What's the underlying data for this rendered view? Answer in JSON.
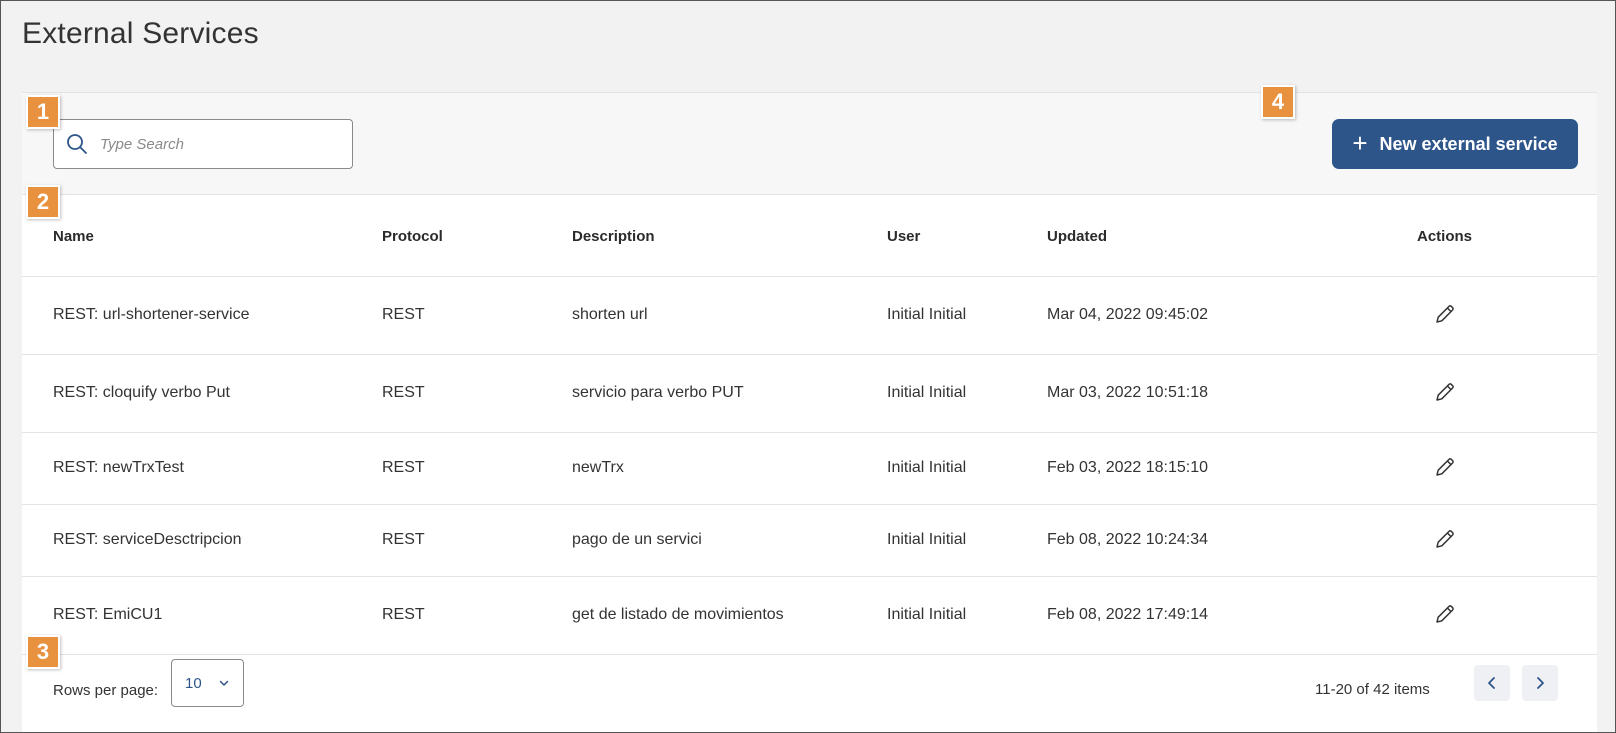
{
  "page": {
    "title": "External Services"
  },
  "toolbar": {
    "search_placeholder": "Type Search",
    "search_value": "",
    "new_button_label": "New external service"
  },
  "badges": [
    "1",
    "2",
    "3",
    "4"
  ],
  "table": {
    "headers": {
      "name": "Name",
      "protocol": "Protocol",
      "description": "Description",
      "user": "User",
      "updated": "Updated",
      "actions": "Actions"
    },
    "rows": [
      {
        "name": "REST: url-shortener-service",
        "protocol": "REST",
        "description": "shorten url",
        "user": "Initial Initial",
        "updated": "Mar 04, 2022 09:45:02"
      },
      {
        "name": "REST: cloquify verbo Put",
        "protocol": "REST",
        "description": "servicio para verbo PUT",
        "user": "Initial Initial",
        "updated": "Mar 03, 2022 10:51:18"
      },
      {
        "name": "REST: newTrxTest",
        "protocol": "REST",
        "description": "newTrx",
        "user": "Initial Initial",
        "updated": "Feb 03, 2022 18:15:10"
      },
      {
        "name": "REST: serviceDesctripcion",
        "protocol": "REST",
        "description": "pago de un servici",
        "user": "Initial Initial",
        "updated": "Feb 08, 2022 10:24:34"
      },
      {
        "name": "REST: EmiCU1",
        "protocol": "REST",
        "description": "get de listado de movimientos",
        "user": "Initial Initial",
        "updated": "Feb 08, 2022 17:49:14"
      }
    ]
  },
  "pagination": {
    "rows_per_page_label": "Rows per page:",
    "rows_per_page_value": "10",
    "items_summary": "11-20 of 42 items"
  },
  "icons": {
    "search": "search-icon",
    "plus": "plus-icon",
    "edit": "pencil-icon",
    "dropdown": "chevron-down-icon",
    "prev": "chevron-left-icon",
    "next": "chevron-right-icon"
  },
  "colors": {
    "primary": "#2d5589",
    "badge": "#e8913f",
    "toolbar_bg": "#f7f7f7",
    "page_bg": "#f2f2f2"
  }
}
